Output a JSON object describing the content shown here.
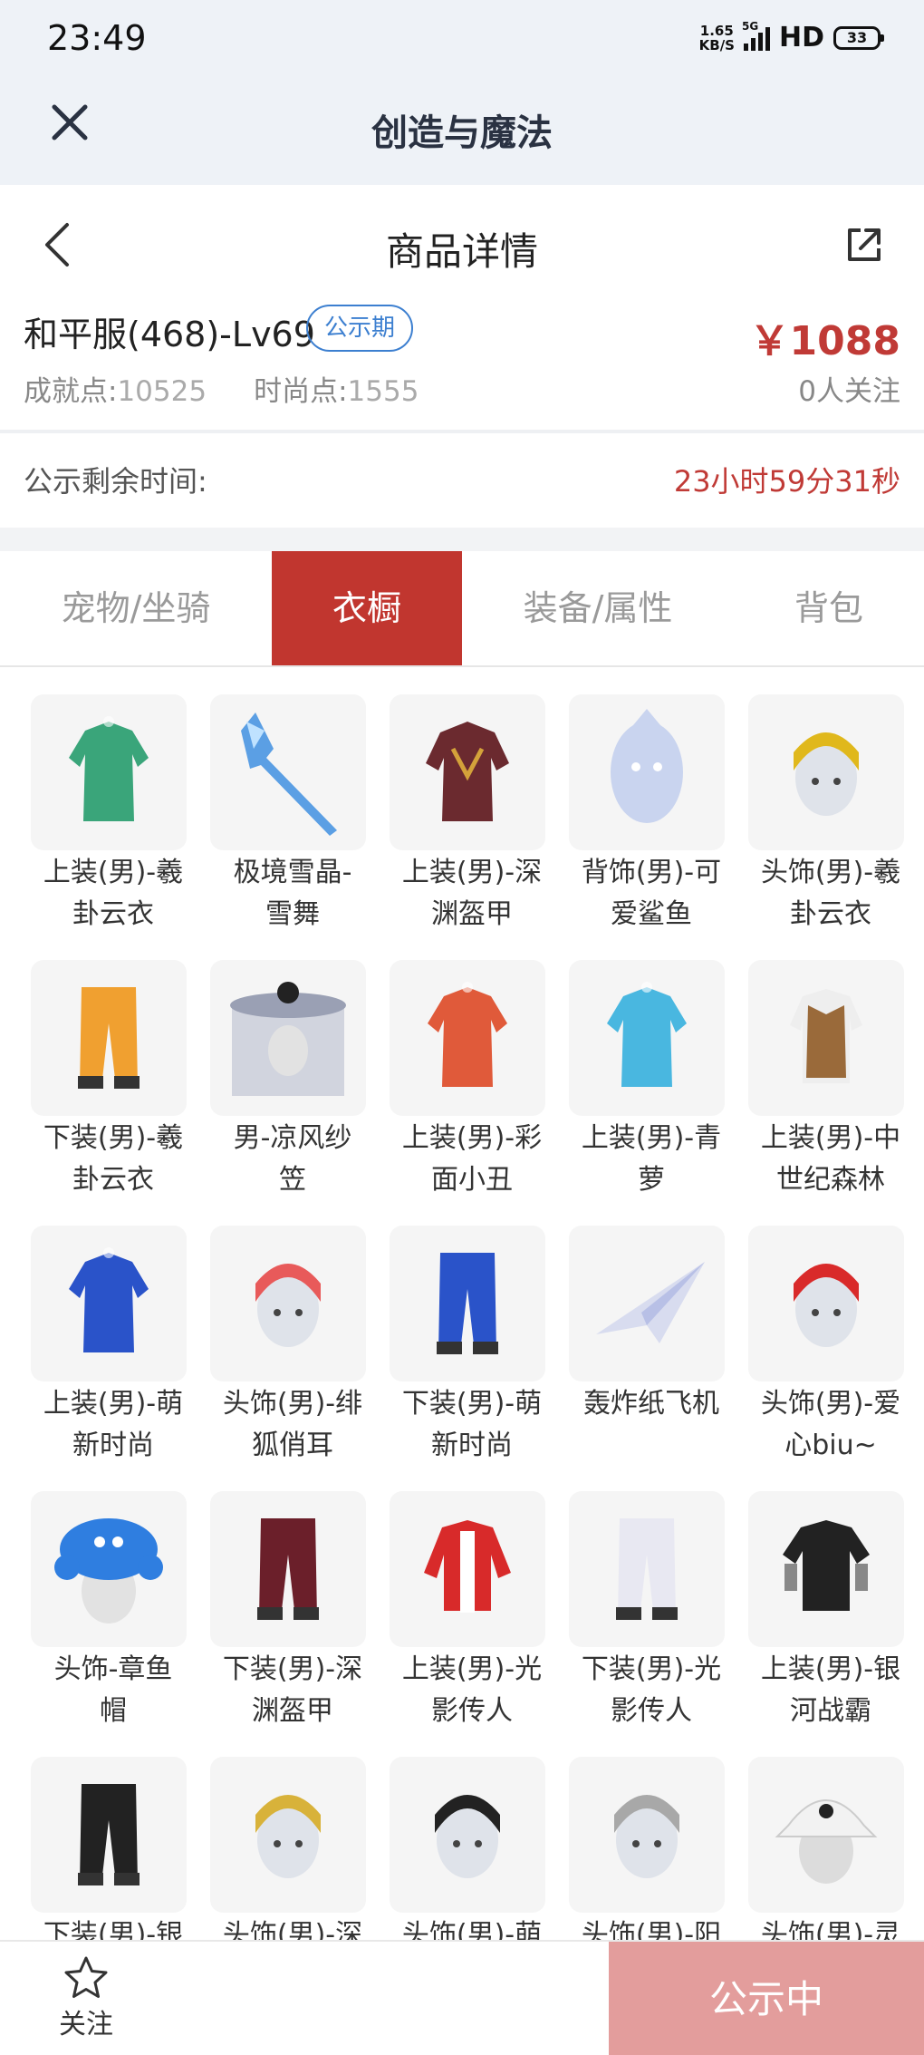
{
  "status_bar": {
    "time": "23:49",
    "net_speed_value": "1.65",
    "net_speed_unit": "KB/S",
    "network": "5G",
    "hd": "HD",
    "battery": "33"
  },
  "app_bar": {
    "title": "创造与魔法",
    "close_icon": "close-icon"
  },
  "page_header": {
    "title": "商品详情",
    "back_icon": "chevron-left-icon",
    "share_icon": "share-icon"
  },
  "listing": {
    "name": "和平服(468)-Lv69",
    "tag": "公示期",
    "price": "￥1088",
    "achievement_label": "成就点:",
    "achievement_value": "10525",
    "fashion_label": "时尚点:",
    "fashion_value": "1555",
    "followers": "0人关注"
  },
  "countdown": {
    "label": "公示剩余时间:",
    "value": "23小时59分31秒"
  },
  "tabs": [
    {
      "label": "宠物/坐骑",
      "active": false
    },
    {
      "label": "衣橱",
      "active": true
    },
    {
      "label": "装备/属性",
      "active": false
    },
    {
      "label": "背包",
      "active": false
    }
  ],
  "wardrobe": [
    {
      "line1": "上装(男)-羲",
      "line2": "卦云衣",
      "icon": "robe-icon",
      "color": "#3aa57a"
    },
    {
      "line1": "极境雪晶-",
      "line2": "雪舞",
      "icon": "crystal-weapon-icon",
      "color": "#3f8fe0"
    },
    {
      "line1": "上装(男)-深",
      "line2": "渊盔甲",
      "icon": "armor-icon",
      "color": "#6b2a2f"
    },
    {
      "line1": "背饰(男)-可",
      "line2": "爱鲨鱼",
      "icon": "shark-icon",
      "color": "#c9d4ef"
    },
    {
      "line1": "头饰(男)-羲",
      "line2": "卦云衣",
      "icon": "head-icon",
      "color": "#e0b81c"
    },
    {
      "line1": "下装(男)-羲",
      "line2": "卦云衣",
      "icon": "pants-icon",
      "color": "#f0a030"
    },
    {
      "line1": "男-凉风纱",
      "line2": "笠",
      "icon": "hat-icon",
      "color": "#c8ccd8"
    },
    {
      "line1": "上装(男)-彩",
      "line2": "面小丑",
      "icon": "robe-icon",
      "color": "#e05a3a"
    },
    {
      "line1": "上装(男)-青",
      "line2": "萝",
      "icon": "robe-icon",
      "color": "#49b7e0"
    },
    {
      "line1": "上装(男)-中",
      "line2": "世纪森林",
      "icon": "vest-icon",
      "color": "#9a6a3a"
    },
    {
      "line1": "上装(男)-萌",
      "line2": "新时尚",
      "icon": "robe-icon",
      "color": "#2a53c9"
    },
    {
      "line1": "头饰(男)-绯",
      "line2": "狐俏耳",
      "icon": "head-icon",
      "color": "#e85a5a"
    },
    {
      "line1": "下装(男)-萌",
      "line2": "新时尚",
      "icon": "pants-icon",
      "color": "#2a53c9"
    },
    {
      "line1": "轰炸纸飞机",
      "line2": "",
      "icon": "paper-plane-icon",
      "color": "#d8dcef"
    },
    {
      "line1": "头饰(男)-爱",
      "line2": "心biu~",
      "icon": "head-icon",
      "color": "#d92a2a"
    },
    {
      "line1": "头饰-章鱼",
      "line2": "帽",
      "icon": "octopus-hat-icon",
      "color": "#2f7ee0"
    },
    {
      "line1": "下装(男)-深",
      "line2": "渊盔甲",
      "icon": "pants-icon",
      "color": "#6b1f2a"
    },
    {
      "line1": "上装(男)-光",
      "line2": "影传人",
      "icon": "jacket-icon",
      "color": "#d82a2a"
    },
    {
      "line1": "下装(男)-光",
      "line2": "影传人",
      "icon": "pants-icon",
      "color": "#e8e8f2"
    },
    {
      "line1": "上装(男)-银",
      "line2": "河战霸",
      "icon": "shirt-icon",
      "color": "#222222"
    },
    {
      "line1": "下装(男)-银",
      "line2": "",
      "icon": "pants-icon",
      "color": "#222222"
    },
    {
      "line1": "头饰(男)-深",
      "line2": "",
      "icon": "head-icon",
      "color": "#d8b23a"
    },
    {
      "line1": "头饰(男)-萌",
      "line2": "",
      "icon": "head-icon",
      "color": "#222222"
    },
    {
      "line1": "头饰(男)-阳",
      "line2": "",
      "icon": "head-icon",
      "color": "#a8a8a8"
    },
    {
      "line1": "头饰(男)-灵",
      "line2": "",
      "icon": "bucket-hat-icon",
      "color": "#f2f2f2"
    }
  ],
  "bottom_bar": {
    "follow_label": "关注",
    "follow_icon": "star-icon",
    "status_label": "公示中"
  },
  "colors": {
    "accent_red": "#c1362f",
    "price_red": "#c03a36",
    "badge_blue": "#3c7fd0",
    "status_button": "#e39d9c"
  }
}
